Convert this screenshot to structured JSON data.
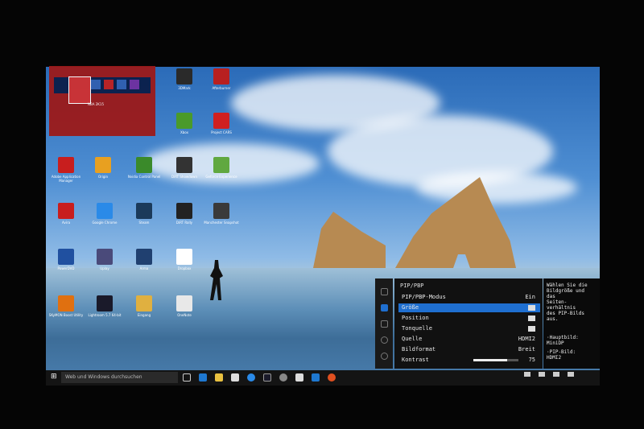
{
  "taskbar": {
    "search_placeholder": "Web und Windows durchsuchen"
  },
  "pip_window": {
    "game_title": "NBA 2K15"
  },
  "desktop_icons": [
    {
      "label": "3DMark",
      "color": "#2a2a2a"
    },
    {
      "label": "Afterburner",
      "color": "#b82020"
    },
    {
      "label": "Xbox",
      "color": "#4a9a2a"
    },
    {
      "label": "Project CARS",
      "color": "#d02020"
    },
    {
      "label": "Adobe Application Manager",
      "color": "#c81e1e"
    },
    {
      "label": "Origin",
      "color": "#e8a020"
    },
    {
      "label": "Nvidia Control Panel",
      "color": "#3a8a2a"
    },
    {
      "label": "DiRT Showdown",
      "color": "#333"
    },
    {
      "label": "Geforce Experience",
      "color": "#60a840"
    },
    {
      "label": "Avira",
      "color": "#c81e1e"
    },
    {
      "label": "Google Chrome",
      "color": "#2a8ae8"
    },
    {
      "label": "Steam",
      "color": "#1b3a5a"
    },
    {
      "label": "DiRT Rally",
      "color": "#222"
    },
    {
      "label": "Manchester Snapshot",
      "color": "#3a3a3a"
    },
    {
      "label": "PowerDVD",
      "color": "#2050a0"
    },
    {
      "label": "Uplay",
      "color": "#4a4a7a"
    },
    {
      "label": "Arma",
      "color": "#204070"
    },
    {
      "label": "Dropbox",
      "color": "#ffffff"
    },
    {
      "label": "SKyMON Boost Utility",
      "color": "#e07010"
    },
    {
      "label": "Lightroom 5.7 64-bit",
      "color": "#1a1a2a"
    },
    {
      "label": "Eingang",
      "color": "#e0b040"
    },
    {
      "label": "OneNote",
      "color": "#e8e8e8"
    }
  ],
  "osd": {
    "title": "PIP/PBP",
    "rows": [
      {
        "label": "PIP/PBP-Modus",
        "value": "Ein"
      },
      {
        "label": "Größe",
        "value": ""
      },
      {
        "label": "Position",
        "value": ""
      },
      {
        "label": "Tonquelle",
        "value": ""
      },
      {
        "label": "Quelle",
        "value": "HDMI2"
      },
      {
        "label": "Bildformat",
        "value": "Breit"
      },
      {
        "label": "Kontrast",
        "value": "75"
      }
    ],
    "contrast_level": 75,
    "help": {
      "lines": [
        "Wählen Sie die",
        "Bildgröße und",
        "das",
        "Seiten-",
        "verhältnis",
        "des PIP-Bilds",
        "aus."
      ],
      "hauptbild": [
        "·Hauptbild:",
        " MiniDP"
      ],
      "pip_bild": [
        "·PIP-Bild:",
        " HDMI2"
      ]
    }
  }
}
